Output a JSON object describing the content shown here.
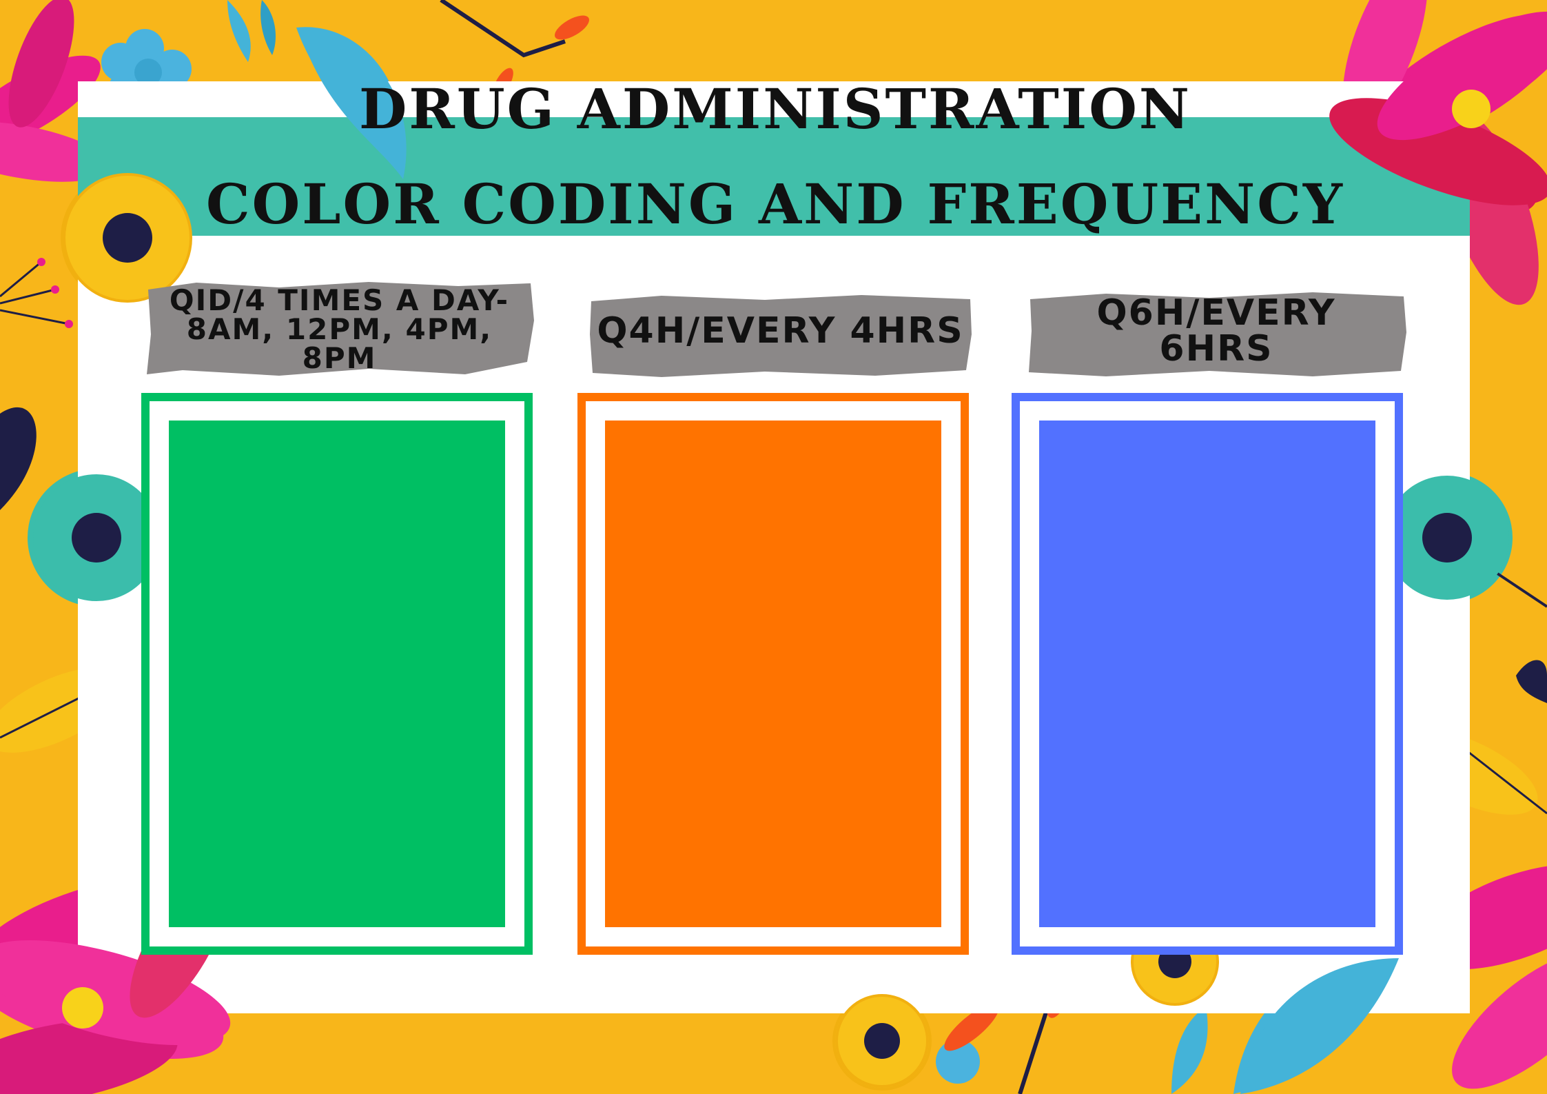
{
  "title": {
    "line1": "DRUG ADMINISTRATION",
    "line2": "COLOR CODING AND FREQUENCY"
  },
  "columns": [
    {
      "label": "QID/4 TIMES A DAY- 8AM, 12PM, 4PM, 8PM",
      "color": "#00bf63"
    },
    {
      "label": "Q4H/EVERY 4HRS",
      "color": "#ff7300"
    },
    {
      "label": "Q6H/EVERY 6HRS",
      "color": "#5271ff"
    }
  ],
  "colors": {
    "background": "#f8b61a",
    "panel": "#ffffff",
    "band": "#41bfaa",
    "label_brush": "#8b8888"
  },
  "decorations": [
    "flower-icon",
    "leaf-icon",
    "twig-icon"
  ]
}
